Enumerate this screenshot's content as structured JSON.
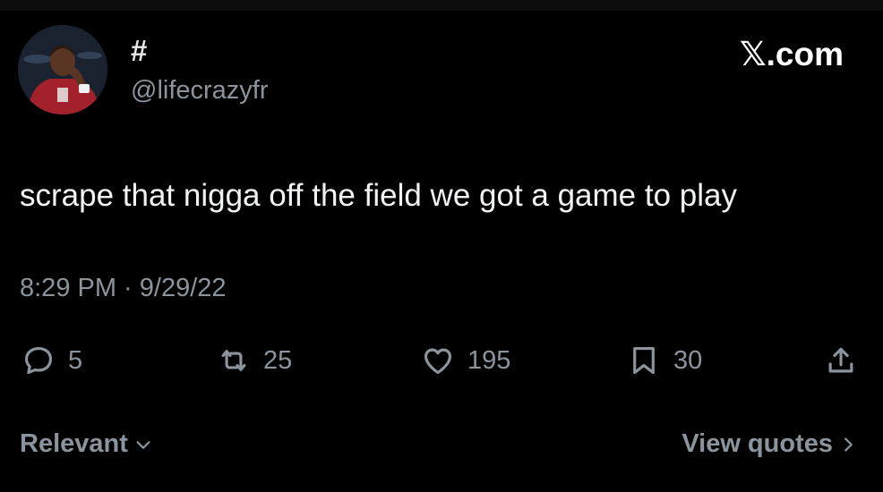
{
  "header": {
    "display_name": "#",
    "handle": "@lifecrazyfr",
    "brand": "𝕏.com"
  },
  "tweet": {
    "text": "scrape that nigga off the field we got a game to play",
    "timestamp": "8:29 PM · 9/29/22"
  },
  "actions": {
    "replies": "5",
    "reposts": "25",
    "likes": "195",
    "bookmarks": "30"
  },
  "footer": {
    "sort_label": "Relevant",
    "quotes_label": "View quotes"
  },
  "icons": {
    "reply": "speech-bubble-icon",
    "repost": "repost-arrows-icon",
    "like": "heart-icon",
    "bookmark": "bookmark-icon",
    "share": "share-upload-icon",
    "sort": "chevron-down-icon",
    "quotes": "chevron-right-icon"
  },
  "colors": {
    "background": "#000000",
    "primary_text": "#e7e9ea",
    "secondary_text": "#8b949c"
  }
}
